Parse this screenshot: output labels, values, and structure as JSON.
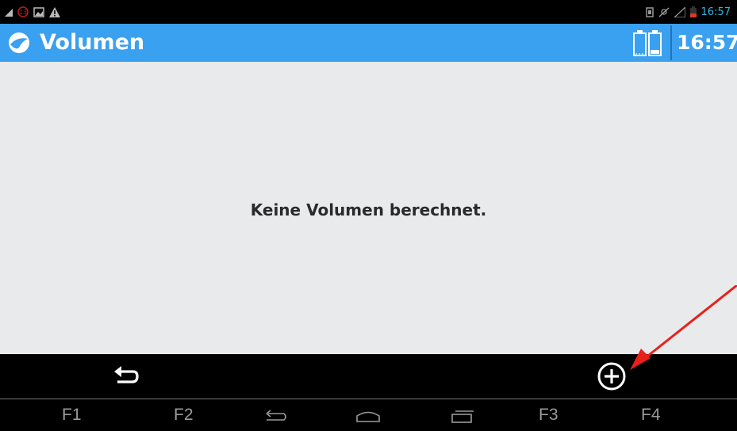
{
  "status_bar": {
    "time": "16:57",
    "icons": [
      "signal-icon",
      "notification-badge-icon",
      "image-icon",
      "warning-icon",
      "sim-icon",
      "no-sound-icon",
      "signal-strength-icon",
      "battery-low-icon"
    ]
  },
  "action_bar": {
    "title": "Volumen",
    "clock": "16:57",
    "accent_color": "#3aa0f0",
    "icons": [
      "app-logo-icon",
      "battery-status-icon"
    ]
  },
  "main": {
    "empty_message": "Keine Volumen berechnet."
  },
  "bottom_bar": {
    "buttons": [
      "back-icon",
      "add-circle-icon"
    ]
  },
  "nav_bar": {
    "keys": [
      "F1",
      "F2",
      "F3",
      "F4"
    ],
    "icons": [
      "back-nav-icon",
      "home-nav-icon",
      "recent-apps-icon"
    ]
  },
  "annotation": {
    "arrow_color": "#e8201a"
  }
}
